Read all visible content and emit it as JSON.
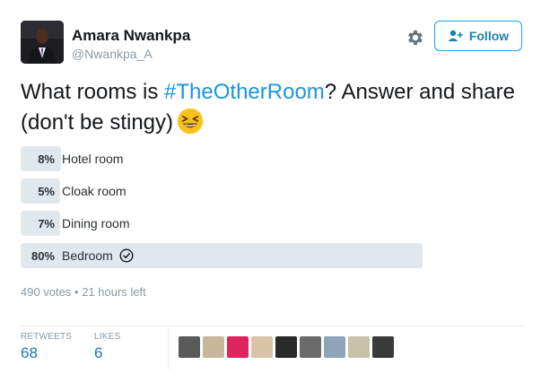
{
  "author": {
    "name": "Amara Nwankpa",
    "handle": "@Nwankpa_A"
  },
  "header": {
    "follow_label": "Follow"
  },
  "tweet": {
    "text_before": "What rooms is ",
    "hashtag": "#TheOtherRoom",
    "text_after": "? Answer and share (don't be stingy)",
    "emoji": "grinning-squinting-face"
  },
  "poll": {
    "options": [
      {
        "percent_label": "8%",
        "percent": 8,
        "label": "Hotel room",
        "selected": false
      },
      {
        "percent_label": "5%",
        "percent": 5,
        "label": "Cloak room",
        "selected": false
      },
      {
        "percent_label": "7%",
        "percent": 7,
        "label": "Dining room",
        "selected": false
      },
      {
        "percent_label": "80%",
        "percent": 80,
        "label": "Bedroom",
        "selected": true
      }
    ],
    "votes": "490 votes",
    "separator": "•",
    "time_left": "21 hours left",
    "leader_color": "#e1e8ed"
  },
  "stats": {
    "retweets_label": "RETWEETS",
    "retweets_value": "68",
    "likes_label": "LIKES",
    "likes_value": "6"
  },
  "likers": [
    {
      "color": "#5a5a5a"
    },
    {
      "color": "#c9b79c"
    },
    {
      "color": "#e0245e"
    },
    {
      "color": "#d9c2a5"
    },
    {
      "color": "#2a2a2a"
    },
    {
      "color": "#6b6b6b"
    },
    {
      "color": "#8fa3b8"
    },
    {
      "color": "#c8c0a8"
    },
    {
      "color": "#3a3a3a"
    }
  ],
  "colors": {
    "link": "#1b95e0",
    "follow_border": "#1da1f2",
    "stat_value": "#1b75bc"
  }
}
